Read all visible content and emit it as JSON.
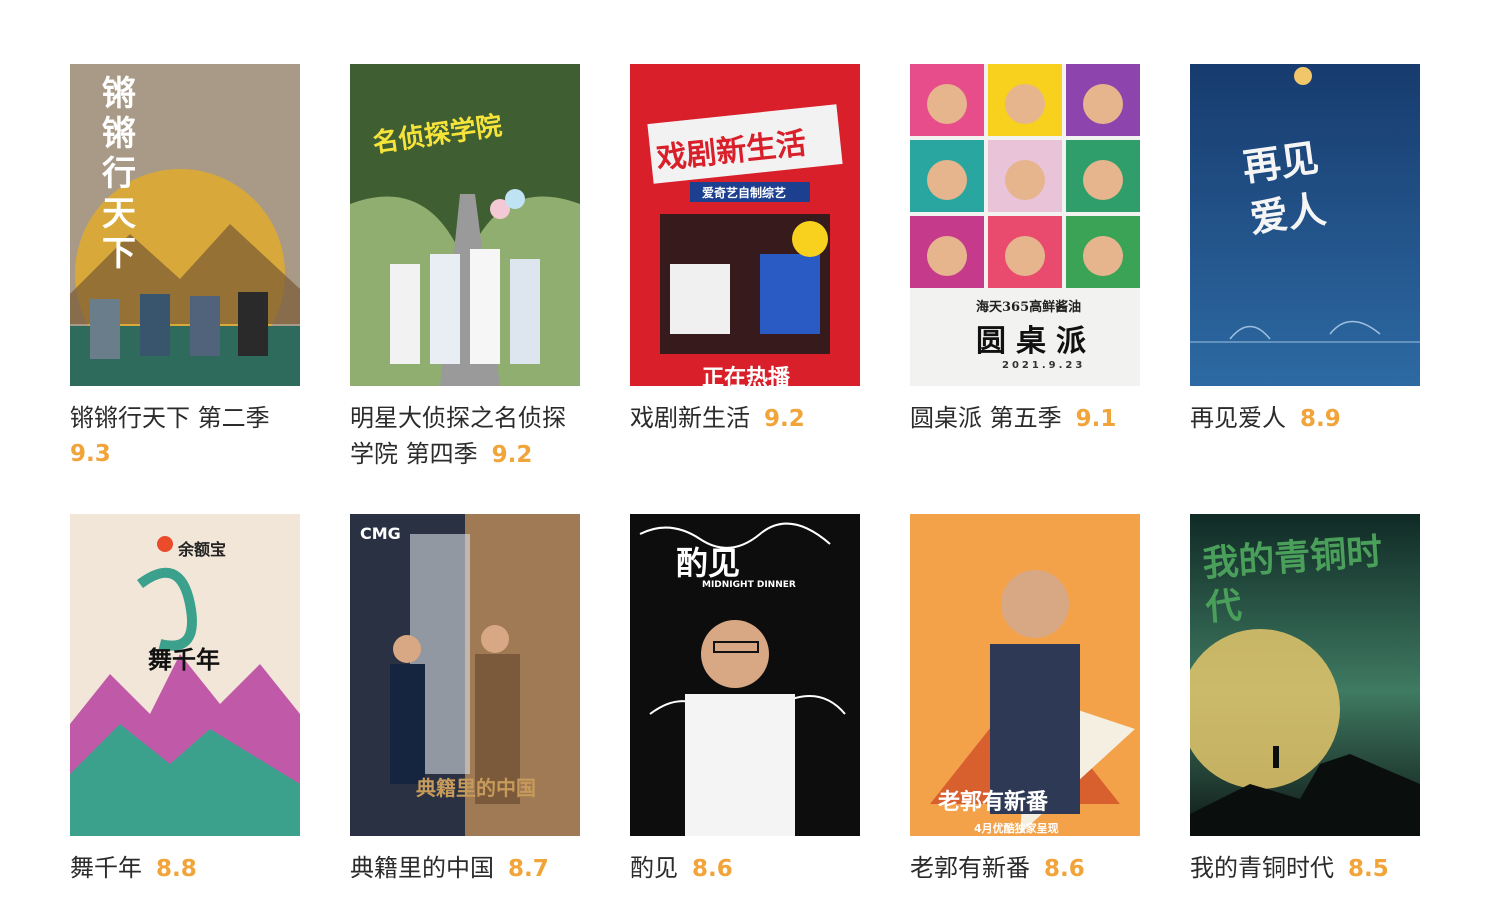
{
  "items": [
    {
      "title": "锵锵行天下 第二季",
      "rating": "9.3",
      "poster_text": "锵锵行天下",
      "colors": [
        "#a89a86",
        "#d8a93a",
        "#2f6b5c"
      ]
    },
    {
      "title": "明星大侦探之名侦探学院 第四季",
      "rating": "9.2",
      "poster_text": "名侦探学院",
      "colors": [
        "#6e8c55",
        "#3f5e32",
        "#9a9a9a"
      ]
    },
    {
      "title": "戏剧新生活",
      "rating": "9.2",
      "poster_text": "戏剧新生活",
      "banner": "爱奇艺自制综艺",
      "bottom": "正在热播",
      "colors": [
        "#d81f2a",
        "#1d3f8f",
        "#f5f5f5"
      ]
    },
    {
      "title": "圆桌派 第五季",
      "rating": "9.1",
      "poster_text": "圆桌派",
      "sub": "海天365高鲜酱油",
      "date": "2021.9.23",
      "colors": [
        "#f2f2f0",
        "#e74c8b",
        "#f7d11e"
      ]
    },
    {
      "title": "再见爱人",
      "rating": "8.9",
      "poster_text": "再见爱人",
      "colors": [
        "#1f4f8a",
        "#2d6aa3",
        "#f1c66b"
      ]
    },
    {
      "title": "舞千年",
      "rating": "8.8",
      "poster_text": "舞千年",
      "brand": "余额宝",
      "colors": [
        "#f2e6d8",
        "#3ca18c",
        "#c05aa8"
      ]
    },
    {
      "title": "典籍里的中国",
      "rating": "8.7",
      "poster_text": "典籍里的中国",
      "brand": "CMG",
      "colors": [
        "#2a3142",
        "#a07a55",
        "#c69a5b"
      ]
    },
    {
      "title": "酌见",
      "rating": "8.6",
      "poster_text": "酌见",
      "sub": "MIDNIGHT DINNER",
      "colors": [
        "#0d0d0d",
        "#ffffff",
        "#d93a2b"
      ]
    },
    {
      "title": "老郭有新番",
      "rating": "8.6",
      "poster_text": "老郭有新番",
      "sub": "4月优酷独家呈现",
      "colors": [
        "#f3a24a",
        "#d8602f",
        "#2e3a55"
      ]
    },
    {
      "title": "我的青铜时代",
      "rating": "8.5",
      "poster_text": "我的青铜时代",
      "colors": [
        "#102a25",
        "#3f7a62",
        "#e3c66b"
      ]
    }
  ]
}
